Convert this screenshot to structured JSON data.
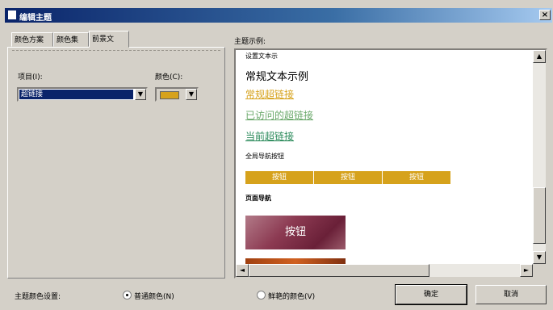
{
  "window": {
    "title": "编辑主题",
    "close_label": "×"
  },
  "tabs": [
    {
      "label": "颜色方案",
      "active": false
    },
    {
      "label": "颜色集",
      "active": false
    },
    {
      "label": "前景文",
      "active": true
    }
  ],
  "left_panel": {
    "item_label": "项目(I):",
    "item_selected": "超链接",
    "color_label": "颜色(C):",
    "color_value": "#d6a21c"
  },
  "preview": {
    "label": "主题示例:",
    "items": {
      "heading": "设置文本示",
      "normal_text": "常规文本示例",
      "link": "常规超链接",
      "visited_link": "已访问的超链接",
      "active_link": "当前超链接",
      "nav_label": "全局导航按钮",
      "nav_buttons": [
        "按钮",
        "按钮",
        "按钮"
      ],
      "banner_label": "页面导航",
      "banner_text": "按钮"
    },
    "colors": {
      "link": "#d6a21c",
      "visited": "#6aa86a",
      "active": "#2a8a5a",
      "nav": "#d6a21c"
    }
  },
  "bottom": {
    "color_setting_label": "主题颜色设置:",
    "option_normal": "普通颜色(N)",
    "option_normal_checked": true,
    "option_vivid": "鲜艳的颜色(V)",
    "option_vivid_checked": false,
    "ok_label": "确定",
    "cancel_label": "取消"
  }
}
